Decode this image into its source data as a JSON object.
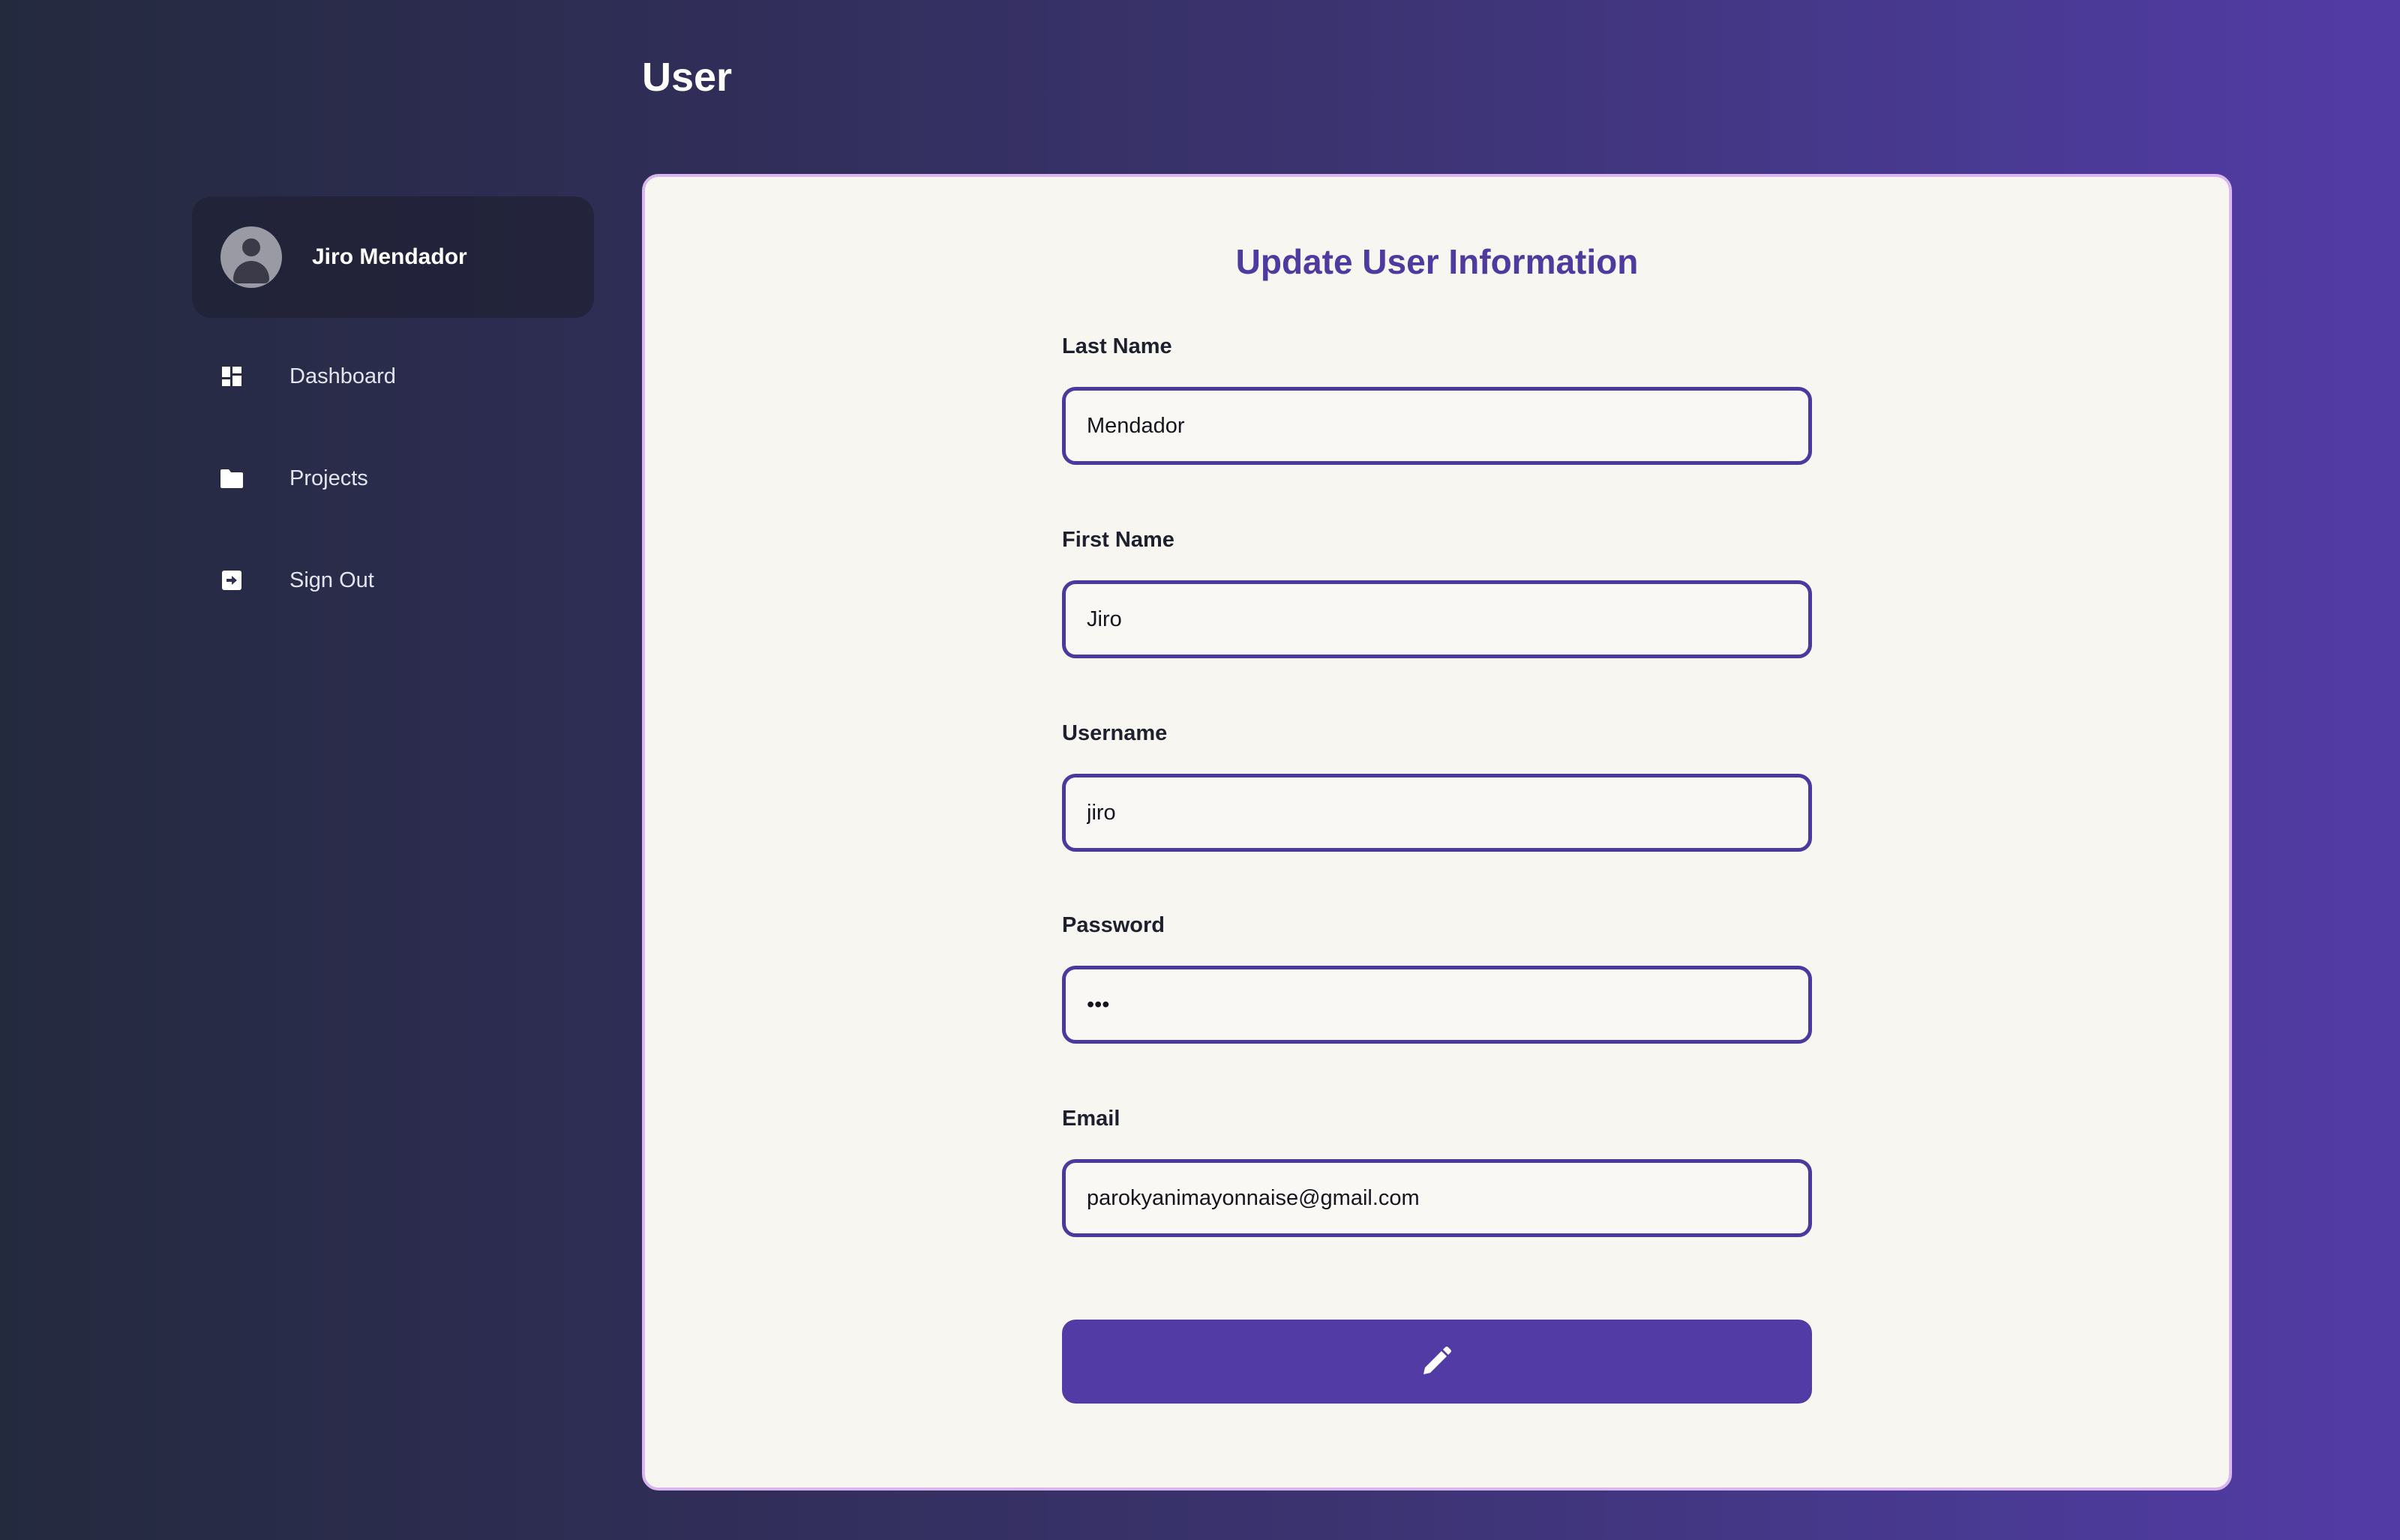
{
  "header": {
    "title": "User"
  },
  "sidebar": {
    "profile": {
      "name": "Jiro Mendador",
      "avatar_icon": "user-circle-icon"
    },
    "items": [
      {
        "label": "Dashboard",
        "icon": "dashboard-icon"
      },
      {
        "label": "Projects",
        "icon": "folder-icon"
      },
      {
        "label": "Sign Out",
        "icon": "sign-out-icon"
      }
    ]
  },
  "form": {
    "title": "Update User Information",
    "fields": {
      "last_name": {
        "label": "Last Name",
        "value": "Mendador"
      },
      "first_name": {
        "label": "First Name",
        "value": "Jiro"
      },
      "username": {
        "label": "Username",
        "value": "jiro"
      },
      "password": {
        "label": "Password",
        "value": "abc"
      },
      "email": {
        "label": "Email",
        "value": "parokyanimayonnaise@gmail.com"
      }
    },
    "submit_icon": "pencil-icon"
  },
  "colors": {
    "accent": "#533ba6",
    "title_accent": "#4f3aa0",
    "input_border": "#4c399d",
    "panel_bg": "#f7f6f1",
    "panel_border": "#d9b6ee"
  }
}
